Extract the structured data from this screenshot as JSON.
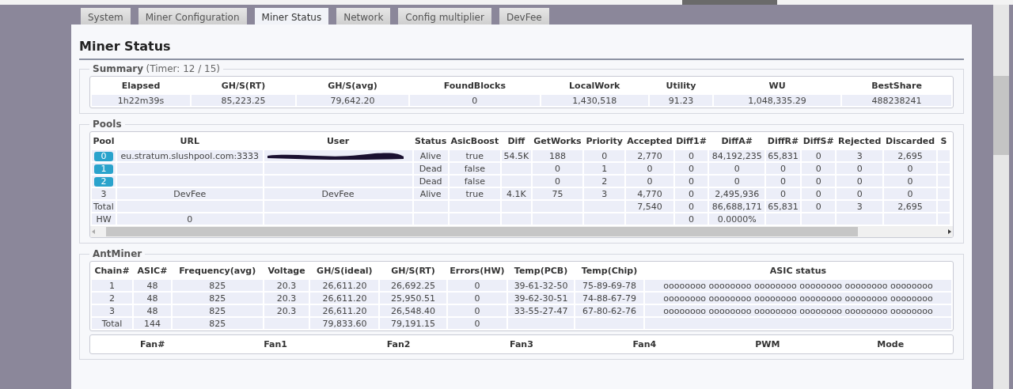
{
  "tabs": [
    {
      "label": "System",
      "selected": false
    },
    {
      "label": "Miner Configuration",
      "selected": false
    },
    {
      "label": "Miner Status",
      "selected": true
    },
    {
      "label": "Network",
      "selected": false
    },
    {
      "label": "Config multiplier",
      "selected": false
    },
    {
      "label": "DevFee",
      "selected": false
    }
  ],
  "page_title": "Miner Status",
  "summary": {
    "legend": "Summary",
    "timer": "(Timer: 12 / 15)",
    "columns": [
      "Elapsed",
      "GH/S(RT)",
      "GH/S(avg)",
      "FoundBlocks",
      "LocalWork",
      "Utility",
      "WU",
      "BestShare"
    ],
    "rows": [
      [
        "1h22m39s",
        "85,223.25",
        "79,642.20",
        "0",
        "1,430,518",
        "91.23",
        "1,048,335.29",
        "488238241"
      ]
    ]
  },
  "pools": {
    "legend": "Pools",
    "columns": [
      "Pool",
      "URL",
      "User",
      "Status",
      "AsicBoost",
      "Diff",
      "GetWorks",
      "Priority",
      "Accepted",
      "Diff1#",
      "DiffA#",
      "DiffR#",
      "DiffS#",
      "Rejected",
      "Discarded",
      "S"
    ],
    "rows": [
      {
        "badge": true,
        "redacted": true,
        "cells": [
          "0",
          "eu.stratum.slushpool.com:3333",
          null,
          "Alive",
          "true",
          "54.5K",
          "188",
          "0",
          "2,770",
          "0",
          "84,192,235",
          "65,831",
          "0",
          "3",
          "2,695",
          null
        ]
      },
      {
        "badge": true,
        "redacted": false,
        "cells": [
          "1",
          null,
          null,
          "Dead",
          "false",
          null,
          "0",
          "1",
          "0",
          "0",
          "0",
          "0",
          "0",
          "0",
          "0",
          null
        ]
      },
      {
        "badge": true,
        "redacted": false,
        "cells": [
          "2",
          null,
          null,
          "Dead",
          "false",
          null,
          "0",
          "2",
          "0",
          "0",
          "0",
          "0",
          "0",
          "0",
          "0",
          null
        ]
      },
      {
        "badge": false,
        "redacted": false,
        "cells": [
          "3",
          "DevFee",
          "DevFee",
          "Alive",
          "true",
          "4.1K",
          "75",
          "3",
          "4,770",
          "0",
          "2,495,936",
          "0",
          "0",
          "0",
          "0",
          null
        ]
      },
      {
        "badge": false,
        "redacted": false,
        "cells": [
          "Total",
          null,
          null,
          null,
          null,
          null,
          null,
          null,
          "7,540",
          "0",
          "86,688,171",
          "65,831",
          "0",
          "3",
          "2,695",
          null
        ]
      },
      {
        "badge": false,
        "redacted": false,
        "cells": [
          "HW",
          "0",
          null,
          null,
          null,
          null,
          null,
          null,
          null,
          "0",
          "0.0000%",
          null,
          null,
          null,
          null,
          null
        ]
      }
    ]
  },
  "antminer": {
    "legend": "AntMiner",
    "columns": [
      "Chain#",
      "ASIC#",
      "Frequency(avg)",
      "Voltage",
      "GH/S(ideal)",
      "GH/S(RT)",
      "Errors(HW)",
      "Temp(PCB)",
      "Temp(Chip)",
      "ASIC status"
    ],
    "rows": [
      [
        "1",
        "48",
        "825",
        "20.3",
        "26,611.20",
        "26,692.25",
        "0",
        "39-61-32-50",
        "75-89-69-78",
        "oooooooo oooooooo oooooooo oooooooo oooooooo oooooooo"
      ],
      [
        "2",
        "48",
        "825",
        "20.3",
        "26,611.20",
        "25,950.51",
        "0",
        "39-62-30-51",
        "74-88-67-79",
        "oooooooo oooooooo oooooooo oooooooo oooooooo oooooooo"
      ],
      [
        "3",
        "48",
        "825",
        "20.3",
        "26,611.20",
        "26,548.40",
        "0",
        "33-55-27-47",
        "67-80-62-76",
        "oooooooo oooooooo oooooooo oooooooo oooooooo oooooooo"
      ],
      [
        "Total",
        "144",
        "825",
        null,
        "79,833.60",
        "79,191.15",
        "0",
        null,
        null,
        null
      ]
    ]
  },
  "fans": {
    "columns": [
      "Fan#",
      "Fan1",
      "Fan2",
      "Fan3",
      "Fan4",
      "PWM",
      "Mode"
    ]
  }
}
